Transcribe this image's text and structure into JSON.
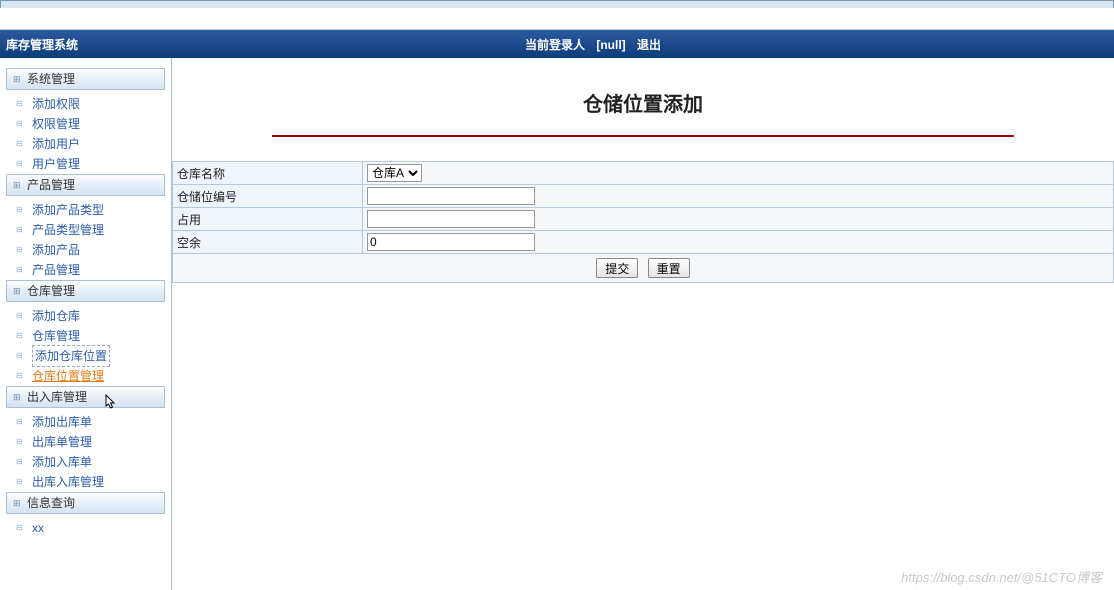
{
  "app_title": "库存管理系统",
  "header": {
    "current_user_label": "当前登录人",
    "user_value": "[null]",
    "logout": "退出"
  },
  "sidebar": {
    "groups": [
      {
        "label": "系统管理",
        "items": [
          {
            "label": "添加权限"
          },
          {
            "label": "权限管理"
          },
          {
            "label": "添加用户"
          },
          {
            "label": "用户管理"
          }
        ]
      },
      {
        "label": "产品管理",
        "items": [
          {
            "label": "添加产品类型"
          },
          {
            "label": "产品类型管理"
          },
          {
            "label": "添加产品"
          },
          {
            "label": "产品管理"
          }
        ]
      },
      {
        "label": "仓库管理",
        "items": [
          {
            "label": "添加仓库"
          },
          {
            "label": "仓库管理"
          },
          {
            "label": "添加仓库位置",
            "dashed": true
          },
          {
            "label": "仓库位置管理",
            "active": true
          }
        ]
      },
      {
        "label": "出入库管理",
        "items": [
          {
            "label": "添加出库单"
          },
          {
            "label": "出库单管理"
          },
          {
            "label": "添加入库单"
          },
          {
            "label": "出库入库管理"
          }
        ]
      },
      {
        "label": "信息查询",
        "items": [
          {
            "label": "xx"
          }
        ]
      }
    ]
  },
  "main": {
    "page_title": "仓储位置添加",
    "form": {
      "rows": [
        {
          "label": "仓库名称",
          "type": "select",
          "value": "仓库A"
        },
        {
          "label": "仓储位编号",
          "type": "text",
          "value": ""
        },
        {
          "label": "占用",
          "type": "text",
          "value": ""
        },
        {
          "label": "空余",
          "type": "text",
          "value": "0"
        }
      ],
      "submit": "提交",
      "reset": "重置"
    }
  },
  "watermark": "https://blog.csdn.net/@51CTO博客"
}
